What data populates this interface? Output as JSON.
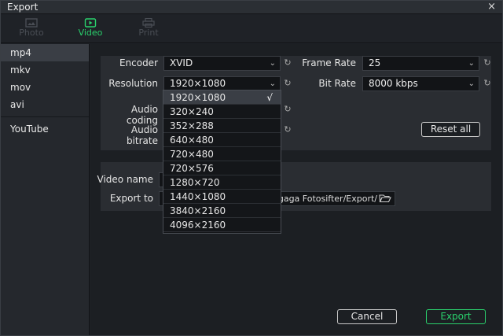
{
  "window": {
    "title": "Export",
    "close_glyph": "×"
  },
  "tabs": [
    {
      "label": "Photo",
      "icon": "image-icon",
      "active": false
    },
    {
      "label": "Video",
      "icon": "video-icon",
      "active": true
    },
    {
      "label": "Print",
      "icon": "printer-icon",
      "active": false
    }
  ],
  "sidebar": {
    "formats": [
      {
        "label": "mp4",
        "active": true
      },
      {
        "label": "mkv",
        "active": false
      },
      {
        "label": "mov",
        "active": false
      },
      {
        "label": "avi",
        "active": false
      }
    ],
    "youtube": "YouTube"
  },
  "settings": {
    "encoder": {
      "label": "Encoder",
      "value": "XVID"
    },
    "resolution": {
      "label": "Resolution",
      "value": "1920×1080"
    },
    "audio_coding": {
      "label": "Audio coding"
    },
    "audio_bitrate": {
      "label": "Audio bitrate"
    },
    "frame_rate": {
      "label": "Frame Rate",
      "value": "25"
    },
    "bit_rate": {
      "label": "Bit Rate",
      "value": "8000 kbps"
    },
    "reset_all": "Reset all"
  },
  "output": {
    "video_name_label": "Video name",
    "export_to_label": "Export to",
    "export_path_visible": "ts/Cgaga Fotosifter/Export/"
  },
  "resolution_options": [
    "1920×1080",
    "320×240",
    "352×288",
    "640×480",
    "720×480",
    "720×576",
    "1280×720",
    "1440×1080",
    "3840×2160",
    "4096×2160"
  ],
  "resolution_selected_index": 0,
  "check_glyph": "√",
  "buttons": {
    "cancel": "Cancel",
    "export": "Export"
  },
  "colors": {
    "accent": "#2ad16d",
    "background": "#1e2126"
  }
}
